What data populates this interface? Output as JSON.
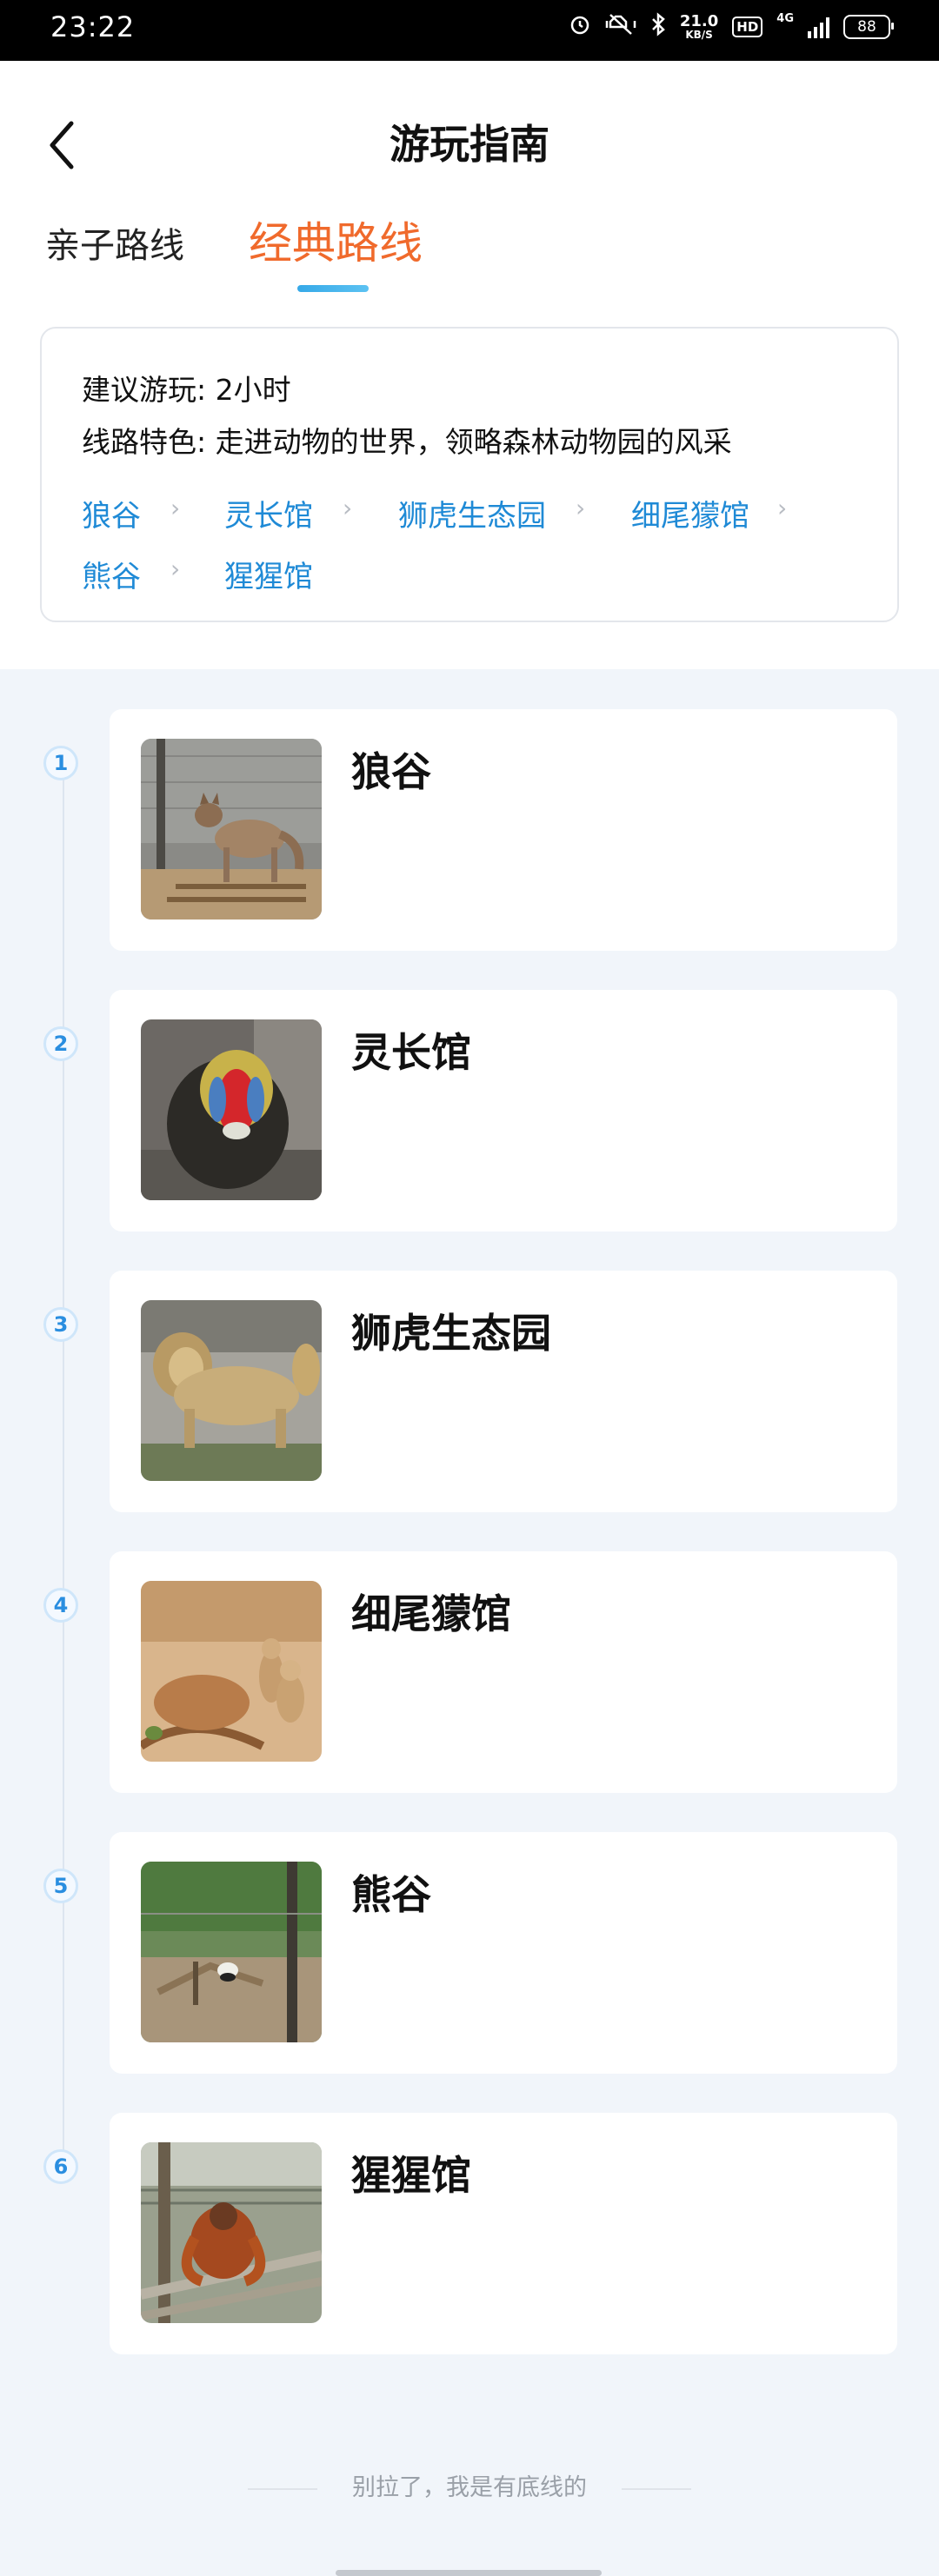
{
  "status_bar": {
    "time": "23:22",
    "net_speed_value": "21.0",
    "net_speed_unit": "KB/S",
    "hd_label": "HD",
    "network_label": "4G",
    "battery": "88"
  },
  "header": {
    "title": "游玩指南",
    "tabs": [
      {
        "label": "亲子路线",
        "active": false
      },
      {
        "label": "经典路线",
        "active": true
      }
    ]
  },
  "route_info": {
    "suggest_label": "建议游玩: 2小时",
    "feature_label": "线路特色: 走进动物的世界，领略森林动物园的风采",
    "stops": [
      "狼谷",
      "灵长馆",
      "狮虎生态园",
      "细尾獴馆",
      "熊谷",
      "猩猩馆"
    ]
  },
  "steps": [
    {
      "num": "1",
      "name": "狼谷",
      "image": "wolf-photo"
    },
    {
      "num": "2",
      "name": "灵长馆",
      "image": "mandrill-photo"
    },
    {
      "num": "3",
      "name": "狮虎生态园",
      "image": "lion-photo"
    },
    {
      "num": "4",
      "name": "细尾獴馆",
      "image": "meerkat-photo"
    },
    {
      "num": "5",
      "name": "熊谷",
      "image": "bear-enclosure-photo"
    },
    {
      "num": "6",
      "name": "猩猩馆",
      "image": "orangutan-photo"
    }
  ],
  "footer": {
    "note": "别拉了，我是有底线的"
  },
  "colors": {
    "accent_orange": "#f06a2c",
    "link_blue": "#1f8ad6",
    "indicator_blue": "#36a9e8",
    "page_bg": "#f1f5fa"
  }
}
